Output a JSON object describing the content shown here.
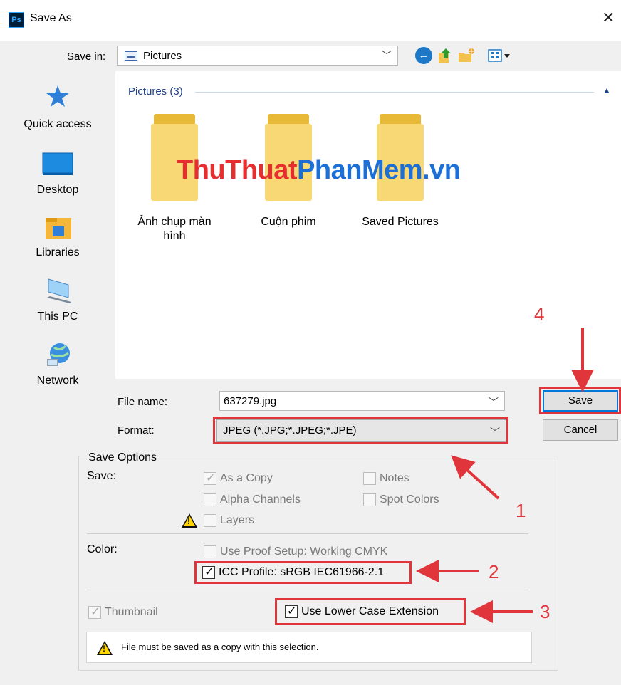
{
  "window": {
    "app_badge": "Ps",
    "title": "Save As",
    "close_glyph": "✕"
  },
  "toolbar": {
    "save_in_label": "Save in:",
    "save_in_value": "Pictures",
    "icons": [
      "back-icon",
      "up-folder-icon",
      "new-folder-icon",
      "view-menu-icon"
    ]
  },
  "nav": {
    "items": [
      {
        "label": "Quick access",
        "icon": "star-icon"
      },
      {
        "label": "Desktop",
        "icon": "desktop-icon"
      },
      {
        "label": "Libraries",
        "icon": "libraries-icon"
      },
      {
        "label": "This PC",
        "icon": "computer-icon"
      },
      {
        "label": "Network",
        "icon": "network-icon"
      }
    ]
  },
  "listing": {
    "group_header": "Pictures (3)",
    "folders": [
      {
        "label": "Ảnh chụp màn hình"
      },
      {
        "label": "Cuộn phim"
      },
      {
        "label": "Saved Pictures"
      }
    ],
    "watermark_part1": "ThuThuat",
    "watermark_part2": "PhanMem.vn"
  },
  "file": {
    "name_label": "File name:",
    "name_value": "637279.jpg",
    "format_label": "Format:",
    "format_value": "JPEG (*.JPG;*.JPEG;*.JPE)"
  },
  "buttons": {
    "save": "Save",
    "cancel": "Cancel"
  },
  "save_options": {
    "title": "Save Options",
    "save_label": "Save:",
    "as_a_copy": "As a Copy",
    "alpha_channels": "Alpha Channels",
    "layers": "Layers",
    "notes": "Notes",
    "spot_colors": "Spot Colors",
    "color_label": "Color:",
    "use_proof_setup": "Use Proof Setup:  Working CMYK",
    "icc_profile": "ICC Profile:  sRGB IEC61966-2.1",
    "thumbnail": "Thumbnail",
    "use_lower_case": "Use Lower Case Extension",
    "warning_message": "File must be saved as a copy with this selection."
  },
  "annotations": {
    "n1": "1",
    "n2": "2",
    "n3": "3",
    "n4": "4"
  },
  "colors": {
    "annotation_red": "#e0353a",
    "accent_blue": "#0078d7",
    "header_blue": "#1e3f8a",
    "folder_yellow": "#f8d775"
  }
}
